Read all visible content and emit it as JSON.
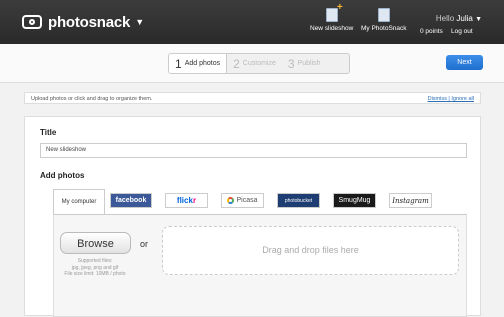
{
  "header": {
    "app_name": "photosnack",
    "new_slideshow_label": "New slideshow",
    "my_photosnack_label": "My PhotoSnack",
    "hello_prefix": "Hello",
    "user_name": "Julia",
    "points_label": "0 points",
    "logout_label": "Log out"
  },
  "wizard": {
    "steps": [
      {
        "num": "1",
        "label": "Add photos"
      },
      {
        "num": "2",
        "label": "Customize"
      },
      {
        "num": "3",
        "label": "Publish"
      }
    ],
    "next_label": "Next"
  },
  "notice": {
    "text": "Upload photos or click and drag to organize them.",
    "dismiss": "Dismiss",
    "ignore_all": "Ignore all"
  },
  "form": {
    "title_label": "Title",
    "title_value": "New slideshow",
    "add_photos_label": "Add photos"
  },
  "sources": {
    "my_computer": "My computer",
    "facebook": "facebook",
    "flickr_a": "flick",
    "flickr_b": "r",
    "picasa": "Picasa",
    "photobucket": "photobucket",
    "smugmug": "SmugMug",
    "instagram": "Instagram"
  },
  "upload": {
    "browse_label": "Browse",
    "supported_line1": "Supported files:",
    "supported_line2": "jpg, jpeg, png and gif",
    "supported_line3": "File size limit: 10MB / photo",
    "or_label": "or",
    "drop_label": "Drag and drop files here"
  }
}
